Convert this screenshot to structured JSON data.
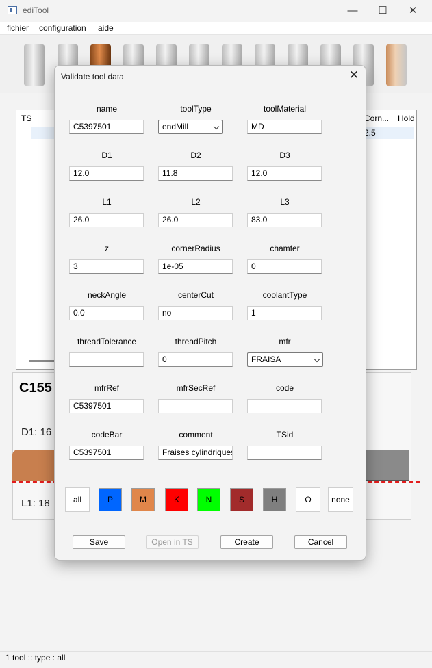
{
  "app": {
    "title": "ediTool"
  },
  "window_controls": {
    "minimize": "—",
    "maximize": "☐",
    "close": "✕"
  },
  "menu": {
    "items": [
      "fichier",
      "configuration",
      "aide"
    ]
  },
  "toolbar": {
    "icons": [
      "cylinder-icon",
      "endmill-icon",
      "bullnose-icon",
      "ballend-icon",
      "chamfer-icon",
      "tslot-icon",
      "spotdrill-icon",
      "drill-icon",
      "taper-icon",
      "engraver-icon",
      "thread-icon",
      "reamer-icon"
    ]
  },
  "list": {
    "headers": [
      "TS",
      "Corn...",
      "Hold"
    ],
    "row_value": "2.5"
  },
  "preview": {
    "title": "C155",
    "d1": "D1: 16",
    "l1": "L1: 18"
  },
  "status": {
    "text": "1 tool :: type : all"
  },
  "dialog": {
    "title": "Validate tool data",
    "close": "✕",
    "fields": [
      {
        "label": "name",
        "value": "C5397501"
      },
      {
        "label": "toolType",
        "value": "endMill",
        "select": true
      },
      {
        "label": "toolMaterial",
        "value": "MD"
      },
      {
        "label": "D1",
        "value": "12.0"
      },
      {
        "label": "D2",
        "value": "11.8"
      },
      {
        "label": "D3",
        "value": "12.0"
      },
      {
        "label": "L1",
        "value": "26.0"
      },
      {
        "label": "L2",
        "value": "26.0"
      },
      {
        "label": "L3",
        "value": "83.0"
      },
      {
        "label": "z",
        "value": "3"
      },
      {
        "label": "cornerRadius",
        "value": "1e-05"
      },
      {
        "label": "chamfer",
        "value": "0"
      },
      {
        "label": "neckAngle",
        "value": "0.0"
      },
      {
        "label": "centerCut",
        "value": "no"
      },
      {
        "label": "coolantType",
        "value": "1"
      },
      {
        "label": "threadTolerance",
        "value": ""
      },
      {
        "label": "threadPitch",
        "value": "0"
      },
      {
        "label": "mfr",
        "value": "FRAISA",
        "select": true
      },
      {
        "label": "mfrRef",
        "value": "C5397501"
      },
      {
        "label": "mfrSecRef",
        "value": ""
      },
      {
        "label": "code",
        "value": ""
      },
      {
        "label": "codeBar",
        "value": "C5397501"
      },
      {
        "label": "comment",
        "value": "Fraises cylindriques"
      },
      {
        "label": "TSid",
        "value": ""
      }
    ],
    "materials": [
      {
        "label": "all",
        "color": "#ffffff"
      },
      {
        "label": "P",
        "color": "#0066ff"
      },
      {
        "label": "M",
        "color": "#e0864a"
      },
      {
        "label": "K",
        "color": "#ff0000"
      },
      {
        "label": "N",
        "color": "#00ff00"
      },
      {
        "label": "S",
        "color": "#a22b2b"
      },
      {
        "label": "H",
        "color": "#7f7f7f"
      },
      {
        "label": "O",
        "color": "#ffffff"
      },
      {
        "label": "none",
        "color": "#ffffff"
      }
    ],
    "actions": [
      {
        "label": "Save",
        "enabled": true
      },
      {
        "label": "Open in TS",
        "enabled": false
      },
      {
        "label": "Create",
        "enabled": true
      },
      {
        "label": "Cancel",
        "enabled": true
      }
    ]
  }
}
